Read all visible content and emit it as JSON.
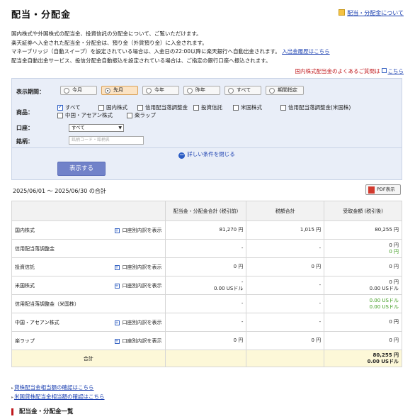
{
  "page": {
    "title": "配当・分配金",
    "help_link": "配当・分配金について"
  },
  "intro": {
    "line1": "国内株式や外国株式の配当金、投資信託の分配金について、ご覧いただけます。",
    "line2": "楽天証券へ入金された配当金・分配金は、預り金（外貨預り金）に入金されます。",
    "line3": "マネーブリッジ（自動スイープ）を設定されている場合は、入金日の22:00以降に楽天銀行へ自動出金されます。",
    "line3_link": "入出金履歴はこちら",
    "line4": "配当金自動出金サービス、投信分配金自動振込を設定されている場合は、ご指定の銀行口座へ振込されます。",
    "faq_text": "国内株式配当金のよくあるご質問は",
    "faq_link": "こちら"
  },
  "filters": {
    "period_label": "表示期間：",
    "periods": [
      "今月",
      "先月",
      "今年",
      "昨年",
      "すべて",
      "期間指定"
    ],
    "selected_period": "先月",
    "product_label": "商品：",
    "products": [
      {
        "label": "すべて",
        "checked": true
      },
      {
        "label": "国内株式",
        "checked": false
      },
      {
        "label": "信用配当落調整金",
        "checked": false
      },
      {
        "label": "投資信託",
        "checked": false
      },
      {
        "label": "米国株式",
        "checked": false
      },
      {
        "label": "信用配当落調整金(米国株)",
        "checked": false
      },
      {
        "label": "中国・アセアン株式",
        "checked": false
      },
      {
        "label": "楽ラップ",
        "checked": false
      }
    ],
    "account_label": "口座：",
    "account_value": "すべて",
    "symbol_label": "銘柄：",
    "symbol_placeholder": "銘柄コード・銘柄名",
    "collapse_label": "詳しい条件を閉じる",
    "show_button": "表示する"
  },
  "summary": {
    "period_text": "2025/06/01 〜 2025/06/30 の合計",
    "pdf_button": "PDF表示",
    "columns": [
      "",
      "配当金・分配金合計 (税引前)",
      "税額合計",
      "受取金額 (税引後)"
    ],
    "breakdown_label": "口座別内訳を表示",
    "rows": [
      {
        "name": "国内株式",
        "has_breakdown": true,
        "pretax": [
          "81,270 円"
        ],
        "tax": [
          "1,015 円"
        ],
        "net": [
          "80,255 円"
        ],
        "net_green": []
      },
      {
        "name": "信用配当落調整金",
        "has_breakdown": false,
        "pretax": [
          "-"
        ],
        "tax": [
          "-"
        ],
        "net": [
          "0 円"
        ],
        "net_green": [
          "0 円"
        ]
      },
      {
        "name": "投資信託",
        "has_breakdown": true,
        "pretax": [
          "0 円"
        ],
        "tax": [
          "0 円"
        ],
        "net": [
          "0 円"
        ],
        "net_green": []
      },
      {
        "name": "米国株式",
        "has_breakdown": true,
        "pretax": [
          "-",
          "0.00 USドル"
        ],
        "tax": [
          "-"
        ],
        "net": [
          "0 円",
          "0.00 USドル"
        ],
        "net_green": []
      },
      {
        "name": "信用配当落調整金（米国株）",
        "has_breakdown": false,
        "pretax": [
          "-"
        ],
        "tax": [
          "-"
        ],
        "net": [],
        "net_green": [
          "0.00 USドル",
          "0.00 USドル"
        ]
      },
      {
        "name": "中国・アセアン株式",
        "has_breakdown": true,
        "pretax": [
          "-"
        ],
        "tax": [
          "-"
        ],
        "net": [
          "0 円"
        ],
        "net_green": []
      },
      {
        "name": "楽ラップ",
        "has_breakdown": true,
        "pretax": [
          "0 円"
        ],
        "tax": [
          "0 円"
        ],
        "net": [
          "0 円"
        ],
        "net_green": []
      }
    ],
    "total_label": "合計",
    "total_net": [
      "80,255 円",
      "0.00 USドル"
    ]
  },
  "links": {
    "lending_jp": "貸株配当金相当額の確認はこちら",
    "lending_us": "米国貸株配当金相当額の確認はこちら"
  },
  "section": {
    "list_title": "配当金・分配金一覧"
  }
}
